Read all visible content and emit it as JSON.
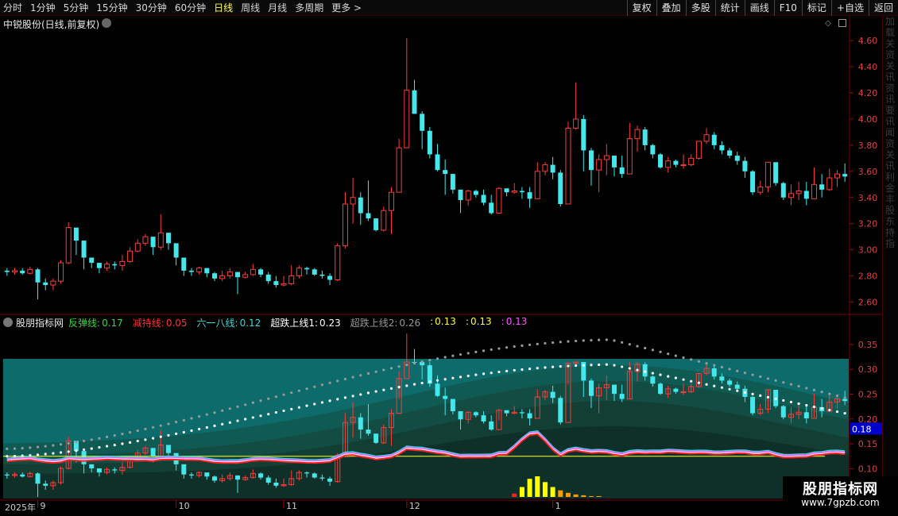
{
  "toolbar": {
    "period_tabs": [
      "分时",
      "1分钟",
      "5分钟",
      "15分钟",
      "30分钟",
      "60分钟",
      "日线",
      "周线",
      "月线",
      "多周期",
      "更多 >"
    ],
    "active_tab_index": 6,
    "right_tools": [
      "复权",
      "叠加",
      "多股",
      "统计",
      "画线",
      "F10",
      "标记",
      "+自选",
      "返回"
    ]
  },
  "stock_title": "中锐股份(日线,前复权)",
  "side_strip_text": [
    "加",
    "载",
    "关",
    "资",
    "关",
    "讯",
    "资",
    "讯",
    "要",
    "讯",
    "闻",
    "资",
    "关",
    "讯",
    "利",
    "金",
    "丰",
    "股",
    "东",
    "持",
    "指"
  ],
  "indicator": {
    "name": "股朋指标网",
    "items": [
      {
        "label": "反弹线:",
        "value": "0.17",
        "color": "#33dd33"
      },
      {
        "label": "减持线:",
        "value": "0.05",
        "color": "#ff3333"
      },
      {
        "label": "六一八线:",
        "value": "0.12",
        "color": "#33dddd"
      },
      {
        "label": "超跌上线1:",
        "value": "0.23",
        "color": "#ffffff"
      },
      {
        "label": "超跌上线2:",
        "value": "0.26",
        "color": "#999999"
      },
      {
        "label": ":",
        "value": "0.13",
        "color": "#ffff33"
      },
      {
        "label": ":",
        "value": "0.13",
        "color": "#ffff33"
      },
      {
        "label": ":",
        "value": "0.13",
        "color": "#ff55ff"
      }
    ],
    "current_value_label": "0.18"
  },
  "date_axis": {
    "year": "2025年",
    "months": [
      {
        "label": "9",
        "index": 4
      },
      {
        "label": "10",
        "index": 22
      },
      {
        "label": "11",
        "index": 36
      },
      {
        "label": "12",
        "index": 52
      },
      {
        "label": "1",
        "index": 71
      }
    ]
  },
  "watermark": {
    "title": "股朋指标网",
    "url": "www.7gpzb.com"
  },
  "colors": {
    "up": "#ff3b3b",
    "down": "#44e8ec",
    "grid": "#3a0000",
    "axis_text": "#e04040"
  },
  "chart_data": [
    {
      "type": "candlestick",
      "title": "中锐股份(日线,前复权)",
      "y_ticks": [
        2.6,
        2.8,
        3.0,
        3.2,
        3.4,
        3.6,
        3.8,
        4.0,
        4.2,
        4.4,
        4.6
      ],
      "ylim": [
        2.53,
        4.68
      ],
      "candles": [
        [
          2.84,
          2.83,
          2.86,
          2.8
        ],
        [
          2.83,
          2.84,
          2.86,
          2.81
        ],
        [
          2.84,
          2.82,
          2.86,
          2.81
        ],
        [
          2.82,
          2.85,
          2.87,
          2.81
        ],
        [
          2.85,
          2.75,
          2.86,
          2.62
        ],
        [
          2.75,
          2.73,
          2.78,
          2.69
        ],
        [
          2.73,
          2.76,
          2.78,
          2.69
        ],
        [
          2.76,
          2.9,
          2.92,
          2.74
        ],
        [
          2.9,
          3.17,
          3.21,
          2.89
        ],
        [
          3.17,
          3.07,
          3.14,
          2.96
        ],
        [
          3.07,
          2.94,
          3.02,
          2.85
        ],
        [
          2.94,
          2.9,
          2.92,
          2.86
        ],
        [
          2.9,
          2.86,
          2.89,
          2.82
        ],
        [
          2.86,
          2.89,
          2.91,
          2.84
        ],
        [
          2.89,
          2.88,
          2.91,
          2.85
        ],
        [
          2.88,
          2.91,
          2.96,
          2.84
        ],
        [
          2.91,
          2.99,
          3.02,
          2.9
        ],
        [
          2.99,
          3.05,
          3.08,
          2.98
        ],
        [
          3.05,
          3.1,
          3.12,
          3.03
        ],
        [
          3.1,
          3.02,
          3.08,
          2.96
        ],
        [
          3.02,
          3.13,
          3.27,
          3.0
        ],
        [
          3.13,
          3.05,
          3.12,
          3.0
        ],
        [
          3.05,
          2.94,
          3.01,
          2.88
        ],
        [
          2.94,
          2.84,
          2.92,
          2.8
        ],
        [
          2.84,
          2.83,
          2.86,
          2.8
        ],
        [
          2.83,
          2.86,
          2.87,
          2.81
        ],
        [
          2.86,
          2.82,
          2.85,
          2.79
        ],
        [
          2.82,
          2.78,
          2.83,
          2.76
        ],
        [
          2.78,
          2.8,
          2.84,
          2.76
        ],
        [
          2.8,
          2.83,
          2.86,
          2.78
        ],
        [
          2.83,
          2.79,
          2.83,
          2.66
        ],
        [
          2.79,
          2.81,
          2.83,
          2.78
        ],
        [
          2.81,
          2.85,
          2.89,
          2.8
        ],
        [
          2.85,
          2.81,
          2.86,
          2.79
        ],
        [
          2.81,
          2.76,
          2.83,
          2.74
        ],
        [
          2.76,
          2.73,
          2.8,
          2.71
        ],
        [
          2.73,
          2.74,
          2.8,
          2.72
        ],
        [
          2.74,
          2.8,
          2.88,
          2.73
        ],
        [
          2.8,
          2.86,
          2.88,
          2.78
        ],
        [
          2.86,
          2.85,
          2.87,
          2.81
        ],
        [
          2.85,
          2.81,
          2.86,
          2.8
        ],
        [
          2.81,
          2.8,
          2.84,
          2.78
        ],
        [
          2.8,
          2.77,
          2.82,
          2.73
        ],
        [
          2.77,
          3.03,
          3.05,
          2.76
        ],
        [
          3.03,
          3.35,
          3.44,
          3.01
        ],
        [
          3.35,
          3.4,
          3.55,
          3.2
        ],
        [
          3.4,
          3.28,
          3.44,
          3.19
        ],
        [
          3.28,
          3.24,
          3.53,
          3.22
        ],
        [
          3.24,
          3.15,
          3.24,
          3.14
        ],
        [
          3.15,
          3.3,
          3.33,
          3.14
        ],
        [
          3.3,
          3.44,
          3.48,
          3.12
        ],
        [
          3.44,
          3.78,
          3.85,
          3.58
        ],
        [
          3.78,
          4.22,
          4.62,
          4.22
        ],
        [
          4.22,
          4.04,
          4.3,
          4.07
        ],
        [
          4.04,
          3.91,
          4.06,
          3.77
        ],
        [
          3.91,
          3.73,
          3.94,
          3.7
        ],
        [
          3.73,
          3.61,
          3.81,
          3.6
        ],
        [
          3.61,
          3.58,
          3.69,
          3.42
        ],
        [
          3.58,
          3.46,
          3.58,
          3.43
        ],
        [
          3.46,
          3.38,
          3.46,
          3.28
        ],
        [
          3.38,
          3.45,
          3.46,
          3.34
        ],
        [
          3.45,
          3.42,
          3.46,
          3.4
        ],
        [
          3.42,
          3.36,
          3.46,
          3.34
        ],
        [
          3.36,
          3.28,
          3.42,
          3.27
        ],
        [
          3.28,
          3.47,
          3.48,
          3.37
        ],
        [
          3.47,
          3.44,
          3.46,
          3.41
        ],
        [
          3.44,
          3.45,
          3.51,
          3.43
        ],
        [
          3.45,
          3.44,
          3.48,
          3.39
        ],
        [
          3.44,
          3.39,
          3.48,
          3.32
        ],
        [
          3.39,
          3.6,
          3.67,
          3.59
        ],
        [
          3.6,
          3.65,
          3.67,
          3.57
        ],
        [
          3.65,
          3.59,
          3.71,
          3.54
        ],
        [
          3.59,
          3.35,
          3.61,
          3.33
        ],
        [
          3.35,
          3.93,
          3.98,
          3.72
        ],
        [
          3.93,
          4.0,
          4.28,
          3.92
        ],
        [
          4.0,
          3.76,
          4.03,
          3.6
        ],
        [
          3.76,
          3.61,
          3.78,
          3.49
        ],
        [
          3.61,
          3.69,
          3.73,
          3.44
        ],
        [
          3.69,
          3.72,
          3.81,
          3.57
        ],
        [
          3.72,
          3.63,
          3.68,
          3.56
        ],
        [
          3.63,
          3.58,
          3.72,
          3.55
        ],
        [
          3.58,
          3.85,
          3.97,
          3.58
        ],
        [
          3.85,
          3.92,
          3.95,
          3.75
        ],
        [
          3.92,
          3.8,
          3.94,
          3.76
        ],
        [
          3.8,
          3.73,
          3.81,
          3.7
        ],
        [
          3.73,
          3.63,
          3.74,
          3.62
        ],
        [
          3.63,
          3.68,
          3.71,
          3.59
        ],
        [
          3.68,
          3.65,
          3.69,
          3.63
        ],
        [
          3.65,
          3.65,
          3.73,
          3.62
        ],
        [
          3.65,
          3.7,
          3.73,
          3.64
        ],
        [
          3.7,
          3.83,
          3.83,
          3.69
        ],
        [
          3.83,
          3.88,
          3.93,
          3.81
        ],
        [
          3.88,
          3.8,
          3.9,
          3.77
        ],
        [
          3.8,
          3.76,
          3.83,
          3.73
        ],
        [
          3.76,
          3.72,
          3.78,
          3.7
        ],
        [
          3.72,
          3.68,
          3.75,
          3.65
        ],
        [
          3.68,
          3.6,
          3.71,
          3.55
        ],
        [
          3.6,
          3.44,
          3.61,
          3.42
        ],
        [
          3.44,
          3.48,
          3.53,
          3.42
        ],
        [
          3.48,
          3.67,
          3.67,
          3.44
        ],
        [
          3.67,
          3.51,
          3.67,
          3.49
        ],
        [
          3.51,
          3.4,
          3.52,
          3.38
        ],
        [
          3.4,
          3.43,
          3.5,
          3.34
        ],
        [
          3.43,
          3.45,
          3.52,
          3.38
        ],
        [
          3.45,
          3.39,
          3.52,
          3.34
        ],
        [
          3.39,
          3.5,
          3.63,
          3.4
        ],
        [
          3.5,
          3.46,
          3.58,
          3.4
        ],
        [
          3.46,
          3.55,
          3.62,
          3.45
        ],
        [
          3.55,
          3.58,
          3.61,
          3.48
        ],
        [
          3.58,
          3.56,
          3.66,
          3.52
        ]
      ]
    },
    {
      "type": "indicator",
      "y_ticks": [
        0.1,
        0.15,
        0.2,
        0.25,
        0.3,
        0.35
      ],
      "ylim": [
        0.04,
        0.385
      ],
      "current_value": 0.18,
      "yellow_line": 0.125,
      "dotted_white_peak": 0.31,
      "dotted_gray_peak": 0.36,
      "volume_bars": [
        0.004,
        0.012,
        0.022,
        0.025,
        0.018,
        0.012,
        0.008,
        0.005,
        0.003,
        0.002,
        0.001,
        0.001
      ]
    }
  ]
}
